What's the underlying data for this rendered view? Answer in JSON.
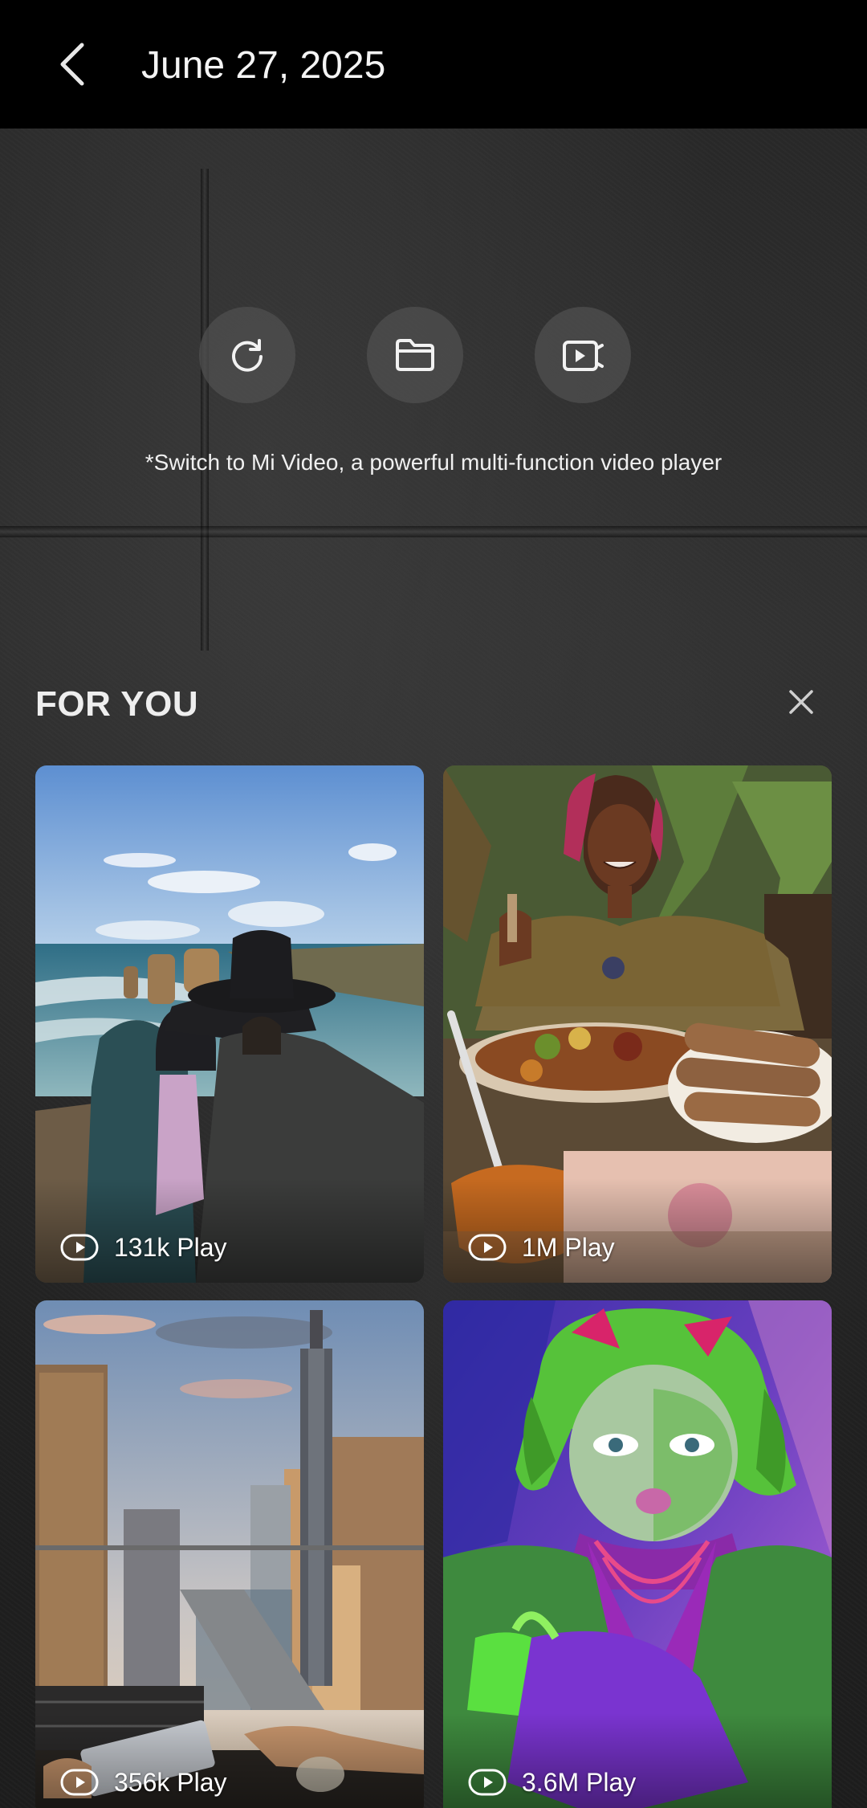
{
  "header": {
    "title": "June 27, 2025",
    "back_icon": "chevron-left-icon"
  },
  "actions": [
    {
      "name": "refresh",
      "icon": "refresh-icon"
    },
    {
      "name": "folder",
      "icon": "folder-icon"
    },
    {
      "name": "video-player",
      "icon": "video-player-icon"
    }
  ],
  "switch_note": "*Switch to Mi Video, a powerful multi-function video player",
  "for_you": {
    "title": "FOR YOU",
    "close_icon": "close-icon",
    "videos": [
      {
        "plays": "131k Play",
        "subject": "coastal-cliffs-travelers"
      },
      {
        "plays": "1M Play",
        "subject": "woman-eating-ethiopian-food"
      },
      {
        "plays": "356k Play",
        "subject": "city-skyline-river-balcony"
      },
      {
        "plays": "3.6M Play",
        "subject": "green-hair-joker-cosplay"
      }
    ]
  },
  "colors": {
    "header_bg": "#000000",
    "button_bg": "#505050",
    "text": "#ffffff"
  }
}
